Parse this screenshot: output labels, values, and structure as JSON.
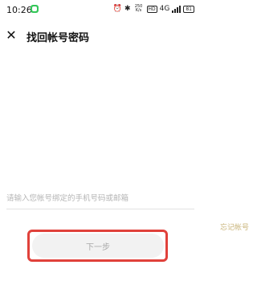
{
  "status_bar": {
    "time": "10:26",
    "net_speed_value": "250",
    "net_speed_unit": "K/s",
    "hd_label": "HD",
    "network_label": "4G",
    "battery_level": "81"
  },
  "header": {
    "close_glyph": "✕",
    "title": "找回帐号密码"
  },
  "form": {
    "phone_placeholder": "请输入您帐号绑定的手机号码或邮箱",
    "phone_value": ""
  },
  "links": {
    "forgot_account": "忘记帐号"
  },
  "actions": {
    "next_label": "下一步"
  },
  "colors": {
    "link": "#c9b47a",
    "highlight": "#e0413b",
    "button_bg": "#f2f2f2",
    "button_text": "#a9a9a9"
  }
}
